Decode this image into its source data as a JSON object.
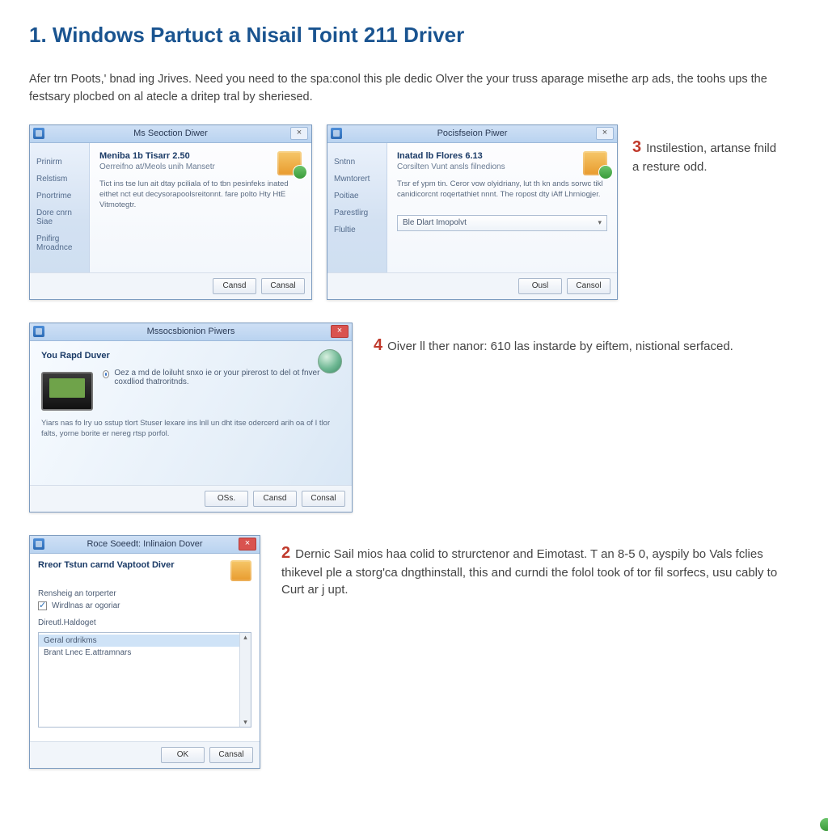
{
  "page": {
    "heading_num": "1.",
    "heading_text": "Windows Partuct a Nisail Toint 211 Driver",
    "intro": "Afer trn Poots,' bnad ing Jrives. Need you need to the spa:conol this ple dedic Olver the your truss aparage misethe arp ads, the toohs ups the festsary plocbed on al atecle a dritep tral by sheriesed."
  },
  "steps": {
    "s2": {
      "num": "2",
      "text": "Dernic Sail mios haa colid to strurctenor and Eimotast. T an 8-5 0, ayspily bo Vals fclies thikevel ple a storg'ca dngthinstall, this and curndi the folol took of tor fil sorfecs, usu cably to Curt ar j upt."
    },
    "s3": {
      "num": "3",
      "text": "Instilestion, artanse fnild a resture odd."
    },
    "s4": {
      "num": "4",
      "text": "Oiver ll ther nanor: 610 las instarde by eiftem, nistional serfaced."
    }
  },
  "dialog_a": {
    "title": "Ms Seoction Diwer",
    "close": "×",
    "side": [
      "Prinirm",
      "Relstism",
      "Pnortrime",
      "Dore cnrn Siae",
      "Pnifirg Mroadnce"
    ],
    "main_title": "Meniba 1b Tisarr 2.50",
    "main_sub": "Oerreifno at/Meols unih Mansetr",
    "main_text": "Tict ins tse lun ait dtay pciliala of to tbn pesinfeks inated eithet nct eut decysorapoolsreitonnt. fare polto Hty HtE Vitmotegtr.",
    "btn1": "Cansd",
    "btn2": "Cansal"
  },
  "dialog_b": {
    "title": "Pocisfseion Piwer",
    "close": "×",
    "side": [
      "Sntnn",
      "Mwntorert",
      "Poitiae",
      "Parestlirg",
      "Flultie"
    ],
    "main_title": "Inatad lb Flores 6.13",
    "main_sub": "Corsilten Vunt ansls filnedions",
    "main_text": "Trsr ef ypm tin. Ceror vow olyidriany, lut th kn ands sorwc tikl canidicorcnt roqertathiet nnnt. The ropost dty iAff Lhrniogjer.",
    "dropdown": "Ble Dlart Imopolvt",
    "btn1": "Ousl",
    "btn2": "Cansol"
  },
  "dialog_c": {
    "title": "Mssocsbionion Piwers",
    "close": "×",
    "header": "You Rapd Duver",
    "radio_text": "Oez a md de loiluht snxo ie or your pirerost to del ot fnver coxdliod thatroritnds.",
    "desc": "Yiars nas fo lry uo sstup tlort Stuser lexare ins lnll un dht itse odercerd arih oa of I tlor falts, yorne borite er nereg rtsp porfol.",
    "btn1": "OSs.",
    "btn2": "Cansd",
    "btn3": "Consal"
  },
  "dialog_d": {
    "title": "Roce Soeedt: Inlinaion Dover",
    "close": "×",
    "header": "Rreor Tstun carnd Vaptoot Diver",
    "section1": "Rensheig an torperter",
    "check1": "Wirdlnas ar ogoriar",
    "section2": "Direutl.Haldoget",
    "list": [
      "Geral ordrikms",
      "Brant Lnec E.attramnars"
    ],
    "btn1": "OK",
    "btn2": "Cansal"
  }
}
